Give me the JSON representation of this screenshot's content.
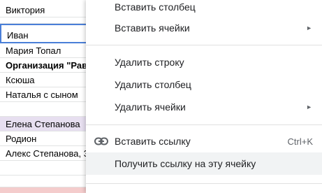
{
  "sheet": {
    "cells": [
      "Виктория",
      "",
      "Иван",
      "Мария Топал",
      "Организация \"Рав",
      "Ксюша",
      "Наталья с сыном",
      "",
      "Елена Степанова",
      "Родион",
      "Алекс Степанова, 3",
      "",
      "",
      ""
    ]
  },
  "menu": {
    "insert_column": "Вставить столбец",
    "insert_cells": "Вставить ячейки",
    "delete_row": "Удалить строку",
    "delete_column": "Удалить столбец",
    "delete_cells": "Удалить ячейки",
    "insert_link": "Вставить ссылку",
    "insert_link_shortcut": "Ctrl+K",
    "get_cell_link": "Получить ссылку на эту ячейку",
    "submenu_arrow": "►"
  },
  "colors": {
    "selection_border": "#4a7fd8",
    "purple_row": "#e7dff0",
    "pink_row": "#f4cccc",
    "hover_bg": "#f1f3f4"
  },
  "icons": {
    "link": "link-icon",
    "submenu": "submenu-arrow-icon"
  }
}
